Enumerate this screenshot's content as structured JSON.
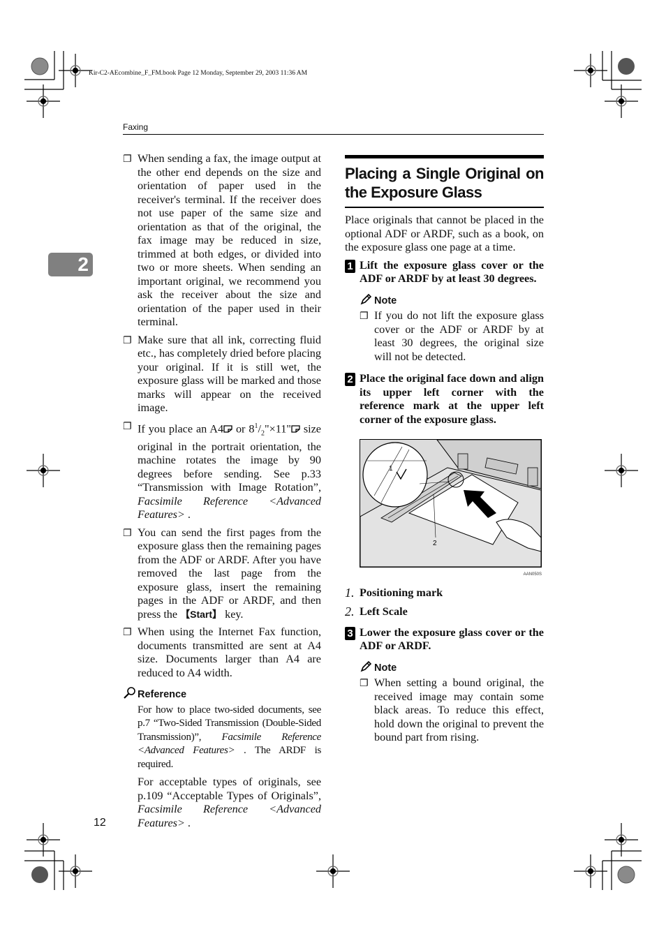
{
  "book_info": "Kir-C2-AEcombine_F_FM.book  Page 12  Monday, September 29, 2003  11:36 AM",
  "running_head": "Faxing",
  "chapter_tab": "2",
  "page_number": "12",
  "left_column": {
    "bullets": [
      {
        "text": "When sending a fax, the image output at the other end depends on the size and orientation of paper used in the receiver's terminal. If the receiver does not use paper of the same size and orientation as that of the original, the fax image may be reduced in size, trimmed at both edges, or divided into two or more sheets. When sending an important original, we recommend you ask the receiver about the size and orientation of the paper used in their terminal."
      },
      {
        "text": "Make sure that all ink, correcting fluid etc., has completely dried before placing your original. If it is still wet, the exposure glass will be marked and those marks will appear on the received image."
      },
      {
        "pre": "If you place an A4",
        "mid": " or 8",
        "sup": "1",
        "sub": "2",
        "post": "\"×11\"",
        "tail": " size original in the portrait orientation, the machine rotates the image by 90 degrees before sending. See p.33 “Transmission with Image Rotation”, ",
        "italic": "Facsimile Reference <Advanced Features>",
        "end": " ."
      },
      {
        "pre": "You can send the first pages from the exposure glass then the remaining pages from the ADF or ARDF. After you have removed the last page from the exposure glass, insert the remaining pages in the ADF or ARDF, and then press the ",
        "key": "【Start】",
        "post": " key."
      },
      {
        "text": "When using the Internet Fax function, documents transmitted are sent at A4 size. Documents larger than A4 are reduced to A4 width."
      }
    ],
    "reference": {
      "heading": "Reference",
      "paragraphs": [
        {
          "pre": "For how to place two-sided documents, see p.7 “Two-Sided Transmission (Double-Sided Transmission)”, ",
          "italic": "Facsimile Reference <Advanced Features>",
          "post": " . The ARDF is required."
        },
        {
          "pre": "For acceptable types of originals, see p.109 “Acceptable Types of Originals”, ",
          "italic": "Facsimile Reference <Advanced Features>",
          "post": " ."
        }
      ]
    }
  },
  "right_column": {
    "section_title": "Placing a Single Original on the Exposure Glass",
    "intro": "Place originals that cannot be placed in the optional ADF or ARDF, such as a book, on the exposure glass one page at a time.",
    "steps": [
      {
        "number": "1",
        "text": "Lift the exposure glass cover or the ADF or ARDF by at least 30 degrees.",
        "note_heading": "Note",
        "note": "If you do not lift the exposure glass cover or the ADF or ARDF by at least 30 degrees, the original size will not be detected."
      },
      {
        "number": "2",
        "text": "Place the original face down and align its upper left corner with the reference mark at the upper left corner of the exposure glass."
      },
      {
        "number": "3",
        "text": "Lower the exposure glass cover or the ADF or ARDF.",
        "note_heading": "Note",
        "note": "When setting a bound original, the received image may contain some black areas. To reduce this effect, hold down the original to prevent the bound part from rising."
      }
    ],
    "figure": {
      "callout_1": "1",
      "callout_2": "2",
      "code": "AAN050S"
    },
    "legend": [
      {
        "num": "1.",
        "label": "Positioning mark"
      },
      {
        "num": "2.",
        "label": "Left Scale"
      }
    ]
  }
}
